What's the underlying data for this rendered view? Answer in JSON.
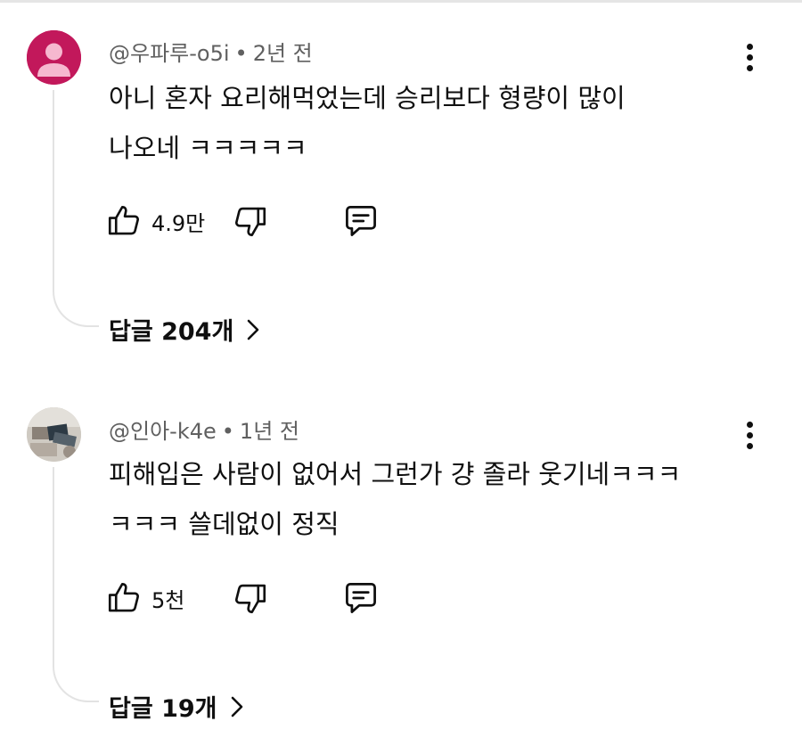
{
  "comments": [
    {
      "author": "@우파루-o5i",
      "time": "2년 전",
      "separator": "•",
      "lines": [
        "아니 혼자 요리해먹었는데 승리보다 형량이 많이",
        "나오네 ㅋㅋㅋㅋㅋ"
      ],
      "likes": "4.9만",
      "replies_label": "답글 204개",
      "avatar_color": "#c2185b"
    },
    {
      "author": "@인아-k4e",
      "time": "1년 전",
      "separator": "•",
      "lines": [
        "피해입은 사람이 없어서 그런가 걍 졸라 웃기네ㅋㅋㅋ",
        "ㅋㅋㅋ 쓸데없이 정직"
      ],
      "likes": "5천",
      "replies_label": "답글 19개"
    }
  ],
  "icons": {
    "like": "thumbs-up-icon",
    "dislike": "thumbs-down-icon",
    "reply": "reply-icon",
    "more": "more-vertical-icon",
    "chevron": "chevron-right-icon"
  }
}
